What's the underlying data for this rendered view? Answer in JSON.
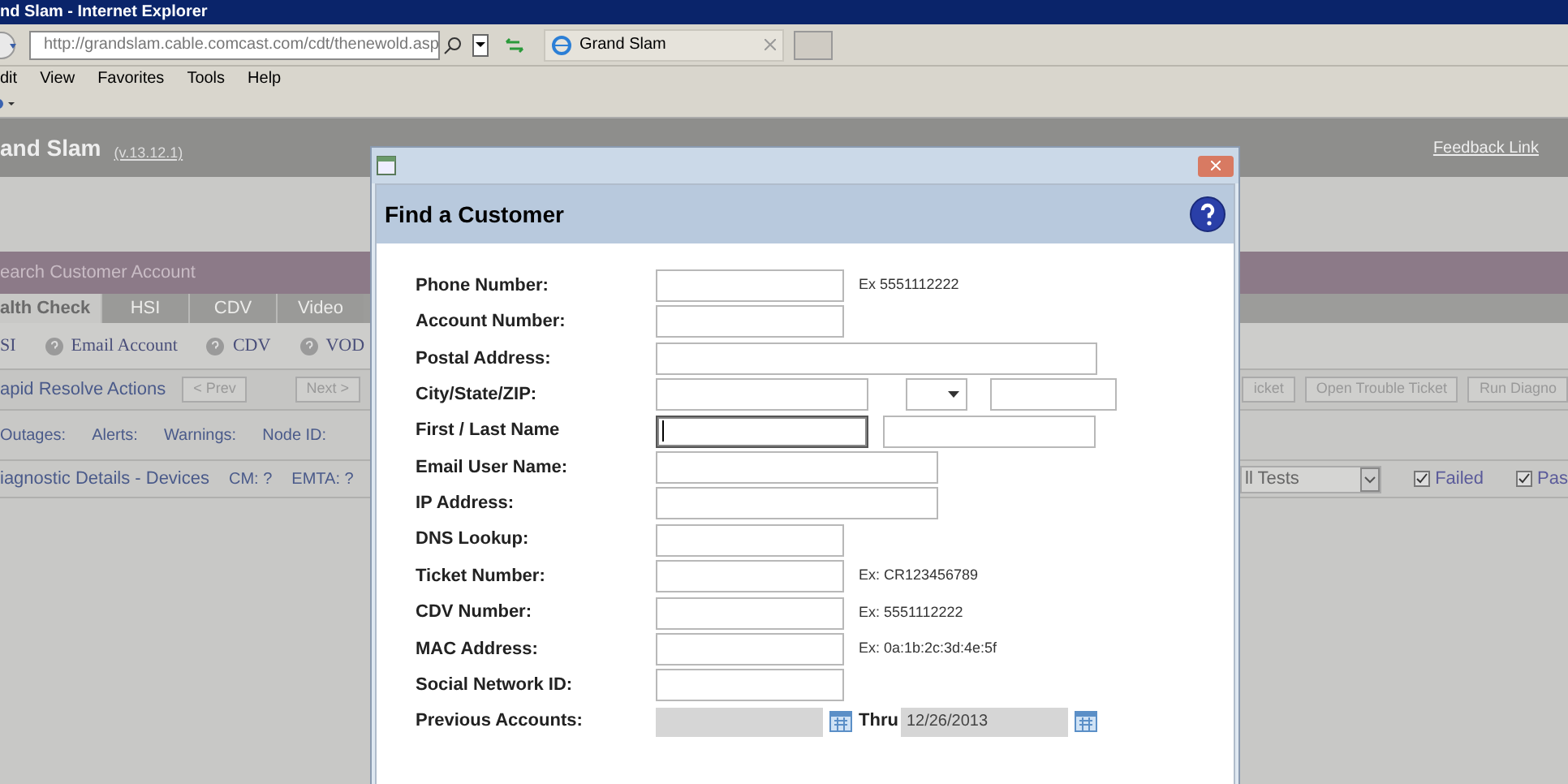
{
  "browser": {
    "title": "nd Slam - Internet Explorer",
    "address": "http://grandslam.cable.comcast.com/cdt/thenewold.asp",
    "tab": "Grand Slam",
    "menu": [
      "dit",
      "View",
      "Favorites",
      "Tools",
      "Help"
    ]
  },
  "app": {
    "title": "and Slam",
    "version": "(v.13.12.1)",
    "feedback": "Feedback Link",
    "search_bar": "earch Customer Account",
    "tabs": [
      {
        "label": "alth Check",
        "selected": true
      },
      {
        "label": "HSI",
        "selected": false
      },
      {
        "label": "CDV",
        "selected": false
      },
      {
        "label": "Video",
        "selected": false
      }
    ],
    "services": [
      {
        "label": "SI",
        "help": false
      },
      {
        "label": "Email Account",
        "help": true
      },
      {
        "label": "CDV",
        "help": true
      },
      {
        "label": "VOD",
        "help": true
      }
    ],
    "rapid": {
      "label": "apid Resolve Actions",
      "prev": "< Prev",
      "next": "Next >",
      "actions": [
        "icket",
        "Open Trouble Ticket",
        "Run Diagno"
      ]
    },
    "status": [
      "Outages:",
      "Alerts:",
      "Warnings:",
      "Node ID:"
    ],
    "diagnostics": {
      "label": "iagnostic Details - Devices",
      "devices": [
        "CM: ?",
        "EMTA: ?"
      ],
      "filter": "ll Tests",
      "checks": [
        {
          "label": "Failed",
          "checked": true
        },
        {
          "label": "Pas",
          "checked": true
        }
      ]
    }
  },
  "dialog": {
    "title": "Find a Customer",
    "fields": [
      {
        "label": "Phone Number:",
        "inputs": [
          {
            "kind": "short"
          }
        ],
        "hint": "Ex 5551112222"
      },
      {
        "label": "Account Number:",
        "inputs": [
          {
            "kind": "short"
          }
        ]
      },
      {
        "label": "Postal Address:",
        "inputs": [
          {
            "kind": "long"
          }
        ]
      },
      {
        "label": "City/State/ZIP:",
        "inputs": [
          {
            "kind": "half"
          },
          {
            "kind": "select"
          },
          {
            "kind": "zip"
          }
        ]
      },
      {
        "label": "First / Last Name",
        "inputs": [
          {
            "kind": "half",
            "focused": true
          },
          {
            "kind": "half",
            "focused": false
          }
        ]
      },
      {
        "label": "Email User Name:",
        "inputs": [
          {
            "kind": "medium"
          }
        ]
      },
      {
        "label": "IP Address:",
        "inputs": [
          {
            "kind": "medium"
          }
        ]
      },
      {
        "label": "DNS Lookup:",
        "inputs": [
          {
            "kind": "short"
          }
        ]
      },
      {
        "label": "Ticket Number:",
        "inputs": [
          {
            "kind": "short"
          }
        ],
        "hint": "Ex: CR123456789"
      },
      {
        "label": "CDV Number:",
        "inputs": [
          {
            "kind": "short"
          }
        ],
        "hint": "Ex: 5551112222"
      },
      {
        "label": "MAC Address:",
        "inputs": [
          {
            "kind": "short"
          }
        ],
        "hint": "Ex: 0a:1b:2c:3d:4e:5f"
      },
      {
        "label": "Social Network ID:",
        "inputs": [
          {
            "kind": "short"
          }
        ]
      }
    ],
    "previous": {
      "label": "Previous Accounts:",
      "thru": "Thru",
      "to": "12/26/2013",
      "disabled": true
    }
  }
}
